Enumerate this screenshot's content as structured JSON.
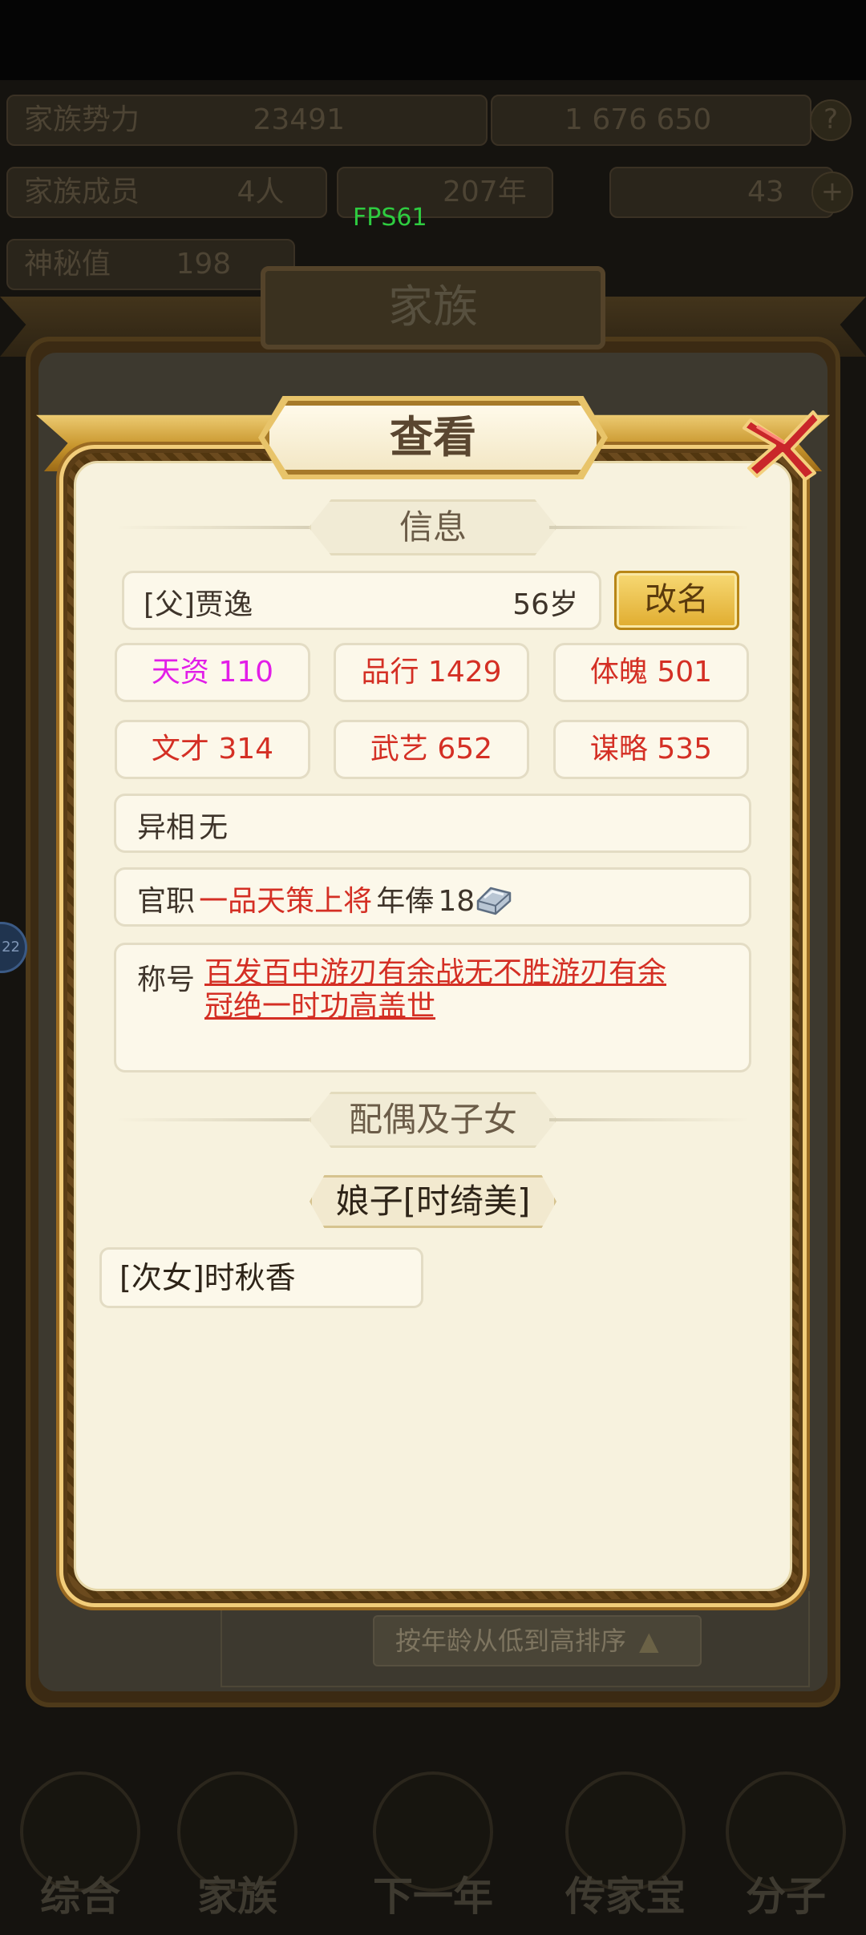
{
  "background": {
    "top_bar_1": {
      "left": "家族势力",
      "mid": "23491",
      "right": "1 676 650"
    },
    "top_bar_2": {
      "left": "家族成员",
      "mid": "4人",
      "right": "207年",
      "far_right": "43"
    },
    "top_bar_3": {
      "left": "神秘值",
      "value": "198"
    },
    "fps": "FPS61",
    "family_title": "家族",
    "sort_button": "按年龄从低到高排序",
    "side_badge": "22",
    "nav": [
      "综合",
      "家族",
      "下一年",
      "传家宝",
      "分子"
    ]
  },
  "modal": {
    "title": "查看",
    "info_header": "信息",
    "name": "[父]贾逸",
    "age": "56岁",
    "rename_button": "改名",
    "stats": [
      {
        "label": "天资 110",
        "color": "#e21ee8"
      },
      {
        "label": "品行 1429",
        "color": "#d42f24"
      },
      {
        "label": "体魄 501",
        "color": "#d42f24"
      },
      {
        "label": "文才 314",
        "color": "#d42f24"
      },
      {
        "label": "武艺 652",
        "color": "#d42f24"
      },
      {
        "label": "谋略 535",
        "color": "#d42f24"
      }
    ],
    "feature": {
      "label": "异相",
      "value": "无"
    },
    "office": {
      "label": "官职",
      "value": "一品天策上将",
      "salary_label": "年俸",
      "salary": "18"
    },
    "titles": {
      "label": "称号",
      "line1": "百发百中游刃有余战无不胜游刃有余",
      "line2": "冠绝一时功高盖世"
    },
    "family_header": "配偶及子女",
    "spouse": "娘子[时绮美]",
    "children": [
      "[次女]时秋香"
    ]
  },
  "colors": {
    "accent_gold": "#e0ac2f",
    "stat_red": "#d42f24",
    "stat_magenta": "#e21ee8",
    "panel_bg": "#f7f2de"
  }
}
